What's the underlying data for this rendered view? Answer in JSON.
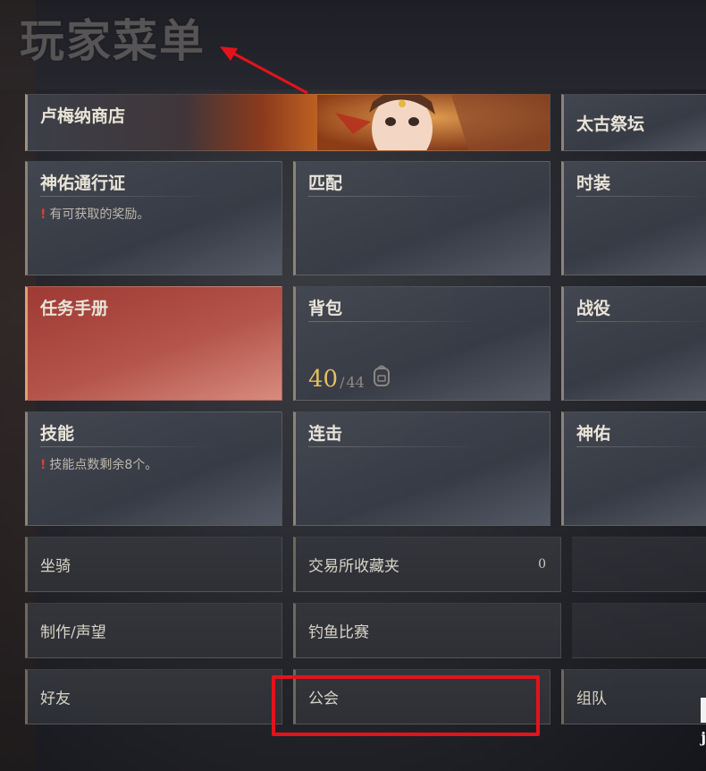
{
  "page": {
    "title": "玩家菜单"
  },
  "tiles": {
    "lumina_shop": {
      "label": "卢梅纳商店"
    },
    "altar": {
      "label": "太古祭坛"
    },
    "pass": {
      "label": "神佑通行证",
      "note": "有可获取的奖励。"
    },
    "match": {
      "label": "匹配"
    },
    "fashion": {
      "label": "时装"
    },
    "quest_book": {
      "label": "任务手册"
    },
    "bag": {
      "label": "背包",
      "current": "40",
      "separator": "/",
      "max": "44"
    },
    "campaign": {
      "label": "战役"
    },
    "skills": {
      "label": "技能",
      "note": "技能点数剩余8个。"
    },
    "combo": {
      "label": "连击"
    },
    "blessing": {
      "label": "神佑"
    },
    "mount": {
      "label": "坐骑"
    },
    "auction_fav": {
      "label": "交易所收藏夹",
      "count": "0"
    },
    "craft": {
      "label": "制作/声望"
    },
    "fishing": {
      "label": "钓鱼比赛"
    },
    "friends": {
      "label": "好友"
    },
    "guild": {
      "label": "公会"
    },
    "party": {
      "label": "组队"
    }
  },
  "alert_mark": "!",
  "edge_text": "j",
  "colors": {
    "highlight": "#e3131c",
    "accent_gold": "#e3bf62",
    "alert": "#d2433a"
  },
  "icons": {
    "bag": "backpack-icon",
    "arrow": "red-arrow-annotation"
  }
}
